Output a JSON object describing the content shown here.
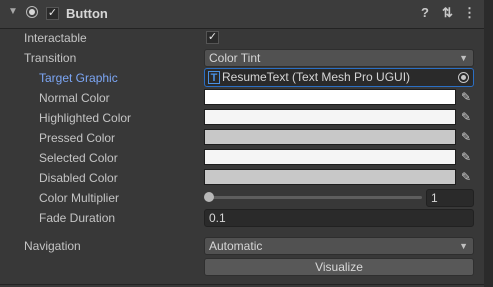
{
  "header": {
    "title": "Button",
    "enabled": true,
    "icons": [
      "help-icon",
      "presets-icon",
      "context-menu-icon"
    ]
  },
  "fields": {
    "interactable": {
      "label": "Interactable",
      "checked": true
    },
    "transition": {
      "label": "Transition",
      "value": "Color Tint"
    },
    "target_graphic": {
      "label": "Target Graphic",
      "value": "ResumeText (Text Mesh Pro UGUI)"
    },
    "normal_color": {
      "label": "Normal Color",
      "color": "#ffffff"
    },
    "highlighted_color": {
      "label": "Highlighted Color",
      "color": "#f5f5f5"
    },
    "pressed_color": {
      "label": "Pressed Color",
      "color": "#c8c8c8"
    },
    "selected_color": {
      "label": "Selected Color",
      "color": "#f5f5f5"
    },
    "disabled_color": {
      "label": "Disabled Color",
      "color": "#c8c8c8"
    },
    "color_multiplier": {
      "label": "Color Multiplier",
      "value": "1",
      "slider_fraction": 0.0
    },
    "fade_duration": {
      "label": "Fade Duration",
      "value": "0.1"
    },
    "navigation": {
      "label": "Navigation",
      "value": "Automatic"
    }
  },
  "visualize_label": "Visualize",
  "colors": {
    "accent": "#7ca6f4",
    "panel": "#383838",
    "field": "#2a2a2a"
  }
}
